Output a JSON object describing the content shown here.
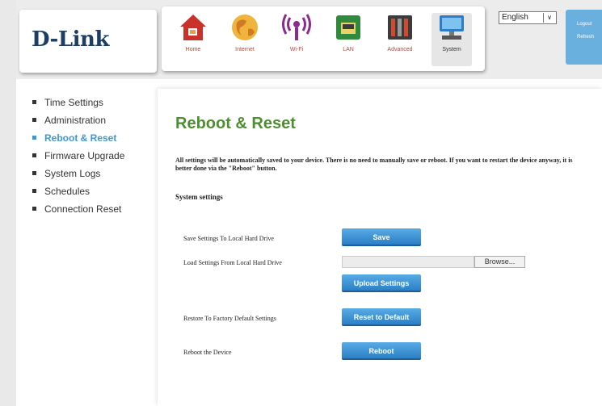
{
  "brand": {
    "logo_text": "D-Link"
  },
  "nav": {
    "items": [
      {
        "label": "Home",
        "icon": "home-icon"
      },
      {
        "label": "Internet",
        "icon": "globe-icon"
      },
      {
        "label": "Wi-Fi",
        "icon": "wifi-icon"
      },
      {
        "label": "LAN",
        "icon": "lan-port-icon"
      },
      {
        "label": "Advanced",
        "icon": "tools-icon"
      },
      {
        "label": "System",
        "icon": "computer-icon"
      }
    ],
    "active": "System"
  },
  "header": {
    "language": "English",
    "logout_label": "Logout",
    "refresh_label": "Refresh"
  },
  "sidebar": {
    "items": [
      {
        "label": "Time Settings"
      },
      {
        "label": "Administration"
      },
      {
        "label": "Reboot & Reset"
      },
      {
        "label": "Firmware Upgrade"
      },
      {
        "label": "System Logs"
      },
      {
        "label": "Schedules"
      },
      {
        "label": "Connection Reset"
      }
    ],
    "active": "Reboot & Reset"
  },
  "main": {
    "title": "Reboot & Reset",
    "intro": "All settings will be automatically saved to your device. There is no need to manually save or reboot. If you want to restart the device anyway, it is better done via the \"Reboot\" button.",
    "section_title": "System settings",
    "rows": {
      "save": {
        "label": "Save Settings To Local Hard Drive",
        "button": "Save"
      },
      "load": {
        "label": "Load Settings From Local Hard Drive",
        "file_value": "",
        "browse": "Browse...",
        "button": "Upload Settings"
      },
      "factory": {
        "label": "Restore To Factory Default Settings",
        "button": "Reset to Default"
      },
      "reboot": {
        "label": "Reboot the Device",
        "button": "Reboot"
      }
    }
  },
  "colors": {
    "title_green": "#4d8f30",
    "active_blue": "#3a98d5",
    "button_blue": "#2b80c6",
    "logo_navy": "#1d3e62"
  }
}
